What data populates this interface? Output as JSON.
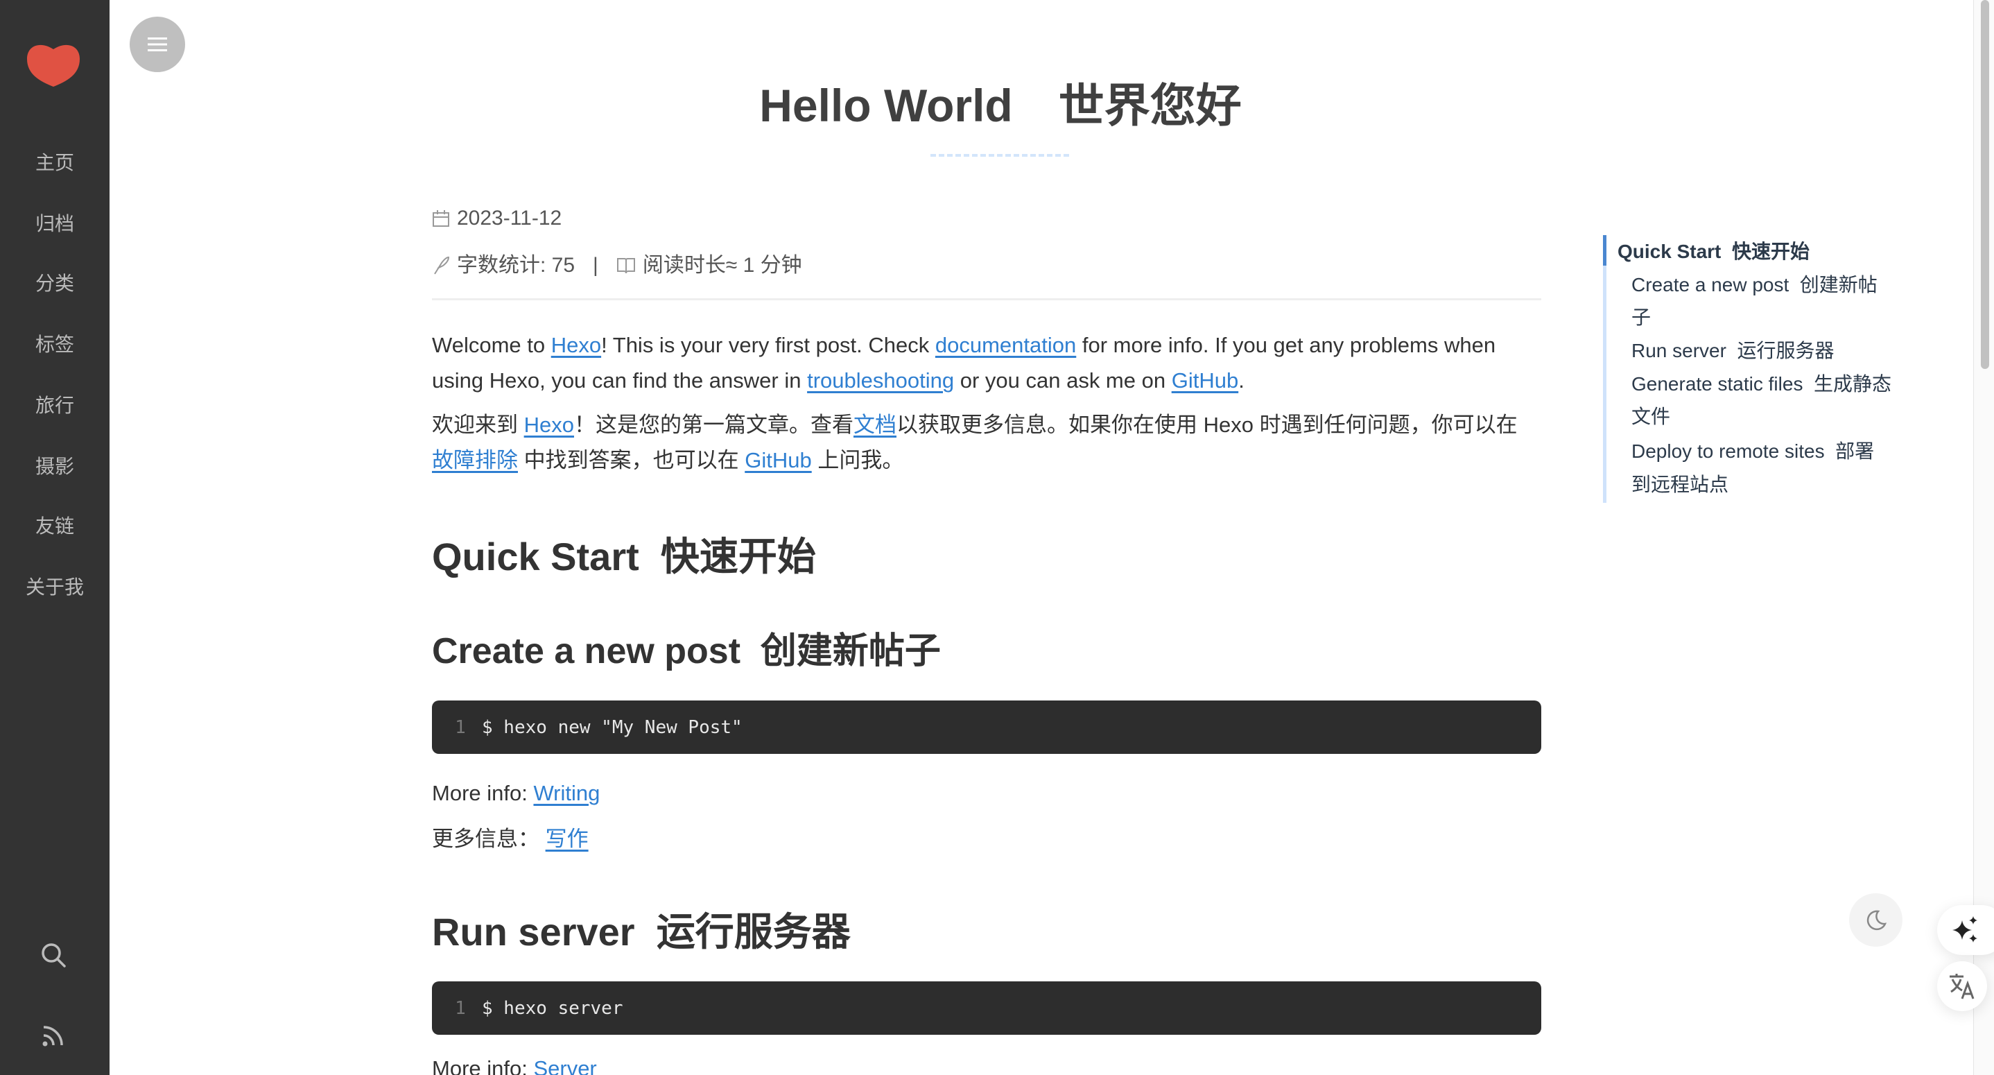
{
  "sidebar": {
    "logo_icon": "heart-icon",
    "logo_color": "#e05243",
    "items": [
      {
        "label": "主页"
      },
      {
        "label": "归档"
      },
      {
        "label": "分类"
      },
      {
        "label": "标签"
      },
      {
        "label": "旅行"
      },
      {
        "label": "摄影"
      },
      {
        "label": "友链"
      },
      {
        "label": "关于我"
      }
    ],
    "search_icon": "search-icon",
    "rss_icon": "rss-icon"
  },
  "header": {
    "menu_icon": "hamburger-icon"
  },
  "post": {
    "title": "Hello World　世界您好",
    "date": "2023-11-12",
    "word_count": "字数统计: 75",
    "separator": "|",
    "read_time": "阅读时长≈ 1 分钟",
    "para1": {
      "t1": "Welcome to ",
      "l1": "Hexo",
      "t2": "! This is your very first post. Check ",
      "l2": "documentation",
      "t3": " for more info. If you get any problems when using Hexo, you can find the answer in ",
      "l3": "troubleshooting",
      "t4": " or you can ask me on ",
      "l4": "GitHub",
      "t5": "."
    },
    "para2": {
      "t1": "欢迎来到 ",
      "l1": "Hexo",
      "t2": "！这是您的第一篇文章。查看",
      "l2": "文档",
      "t3": "以获取更多信息。如果你在使用 Hexo 时遇到任何问题，你可以在 ",
      "l3": "故障排除",
      "t4": " 中找到答案，也可以在 ",
      "l4": "GitHub",
      "t5": " 上问我。"
    },
    "h_quick_start": "Quick Start  快速开始",
    "h_create": "Create a new post  创建新帖子",
    "code1": {
      "line": "1",
      "text": "$ hexo new \"My New Post\""
    },
    "more_info1": {
      "label": "More info: ",
      "link": "Writing"
    },
    "more_info1_cn": {
      "label": "更多信息： ",
      "link": "写作"
    },
    "h_run": "Run server  运行服务器",
    "code2": {
      "line": "1",
      "text": "$ hexo server"
    },
    "more_info2": {
      "label": "More info: ",
      "link": "Server"
    }
  },
  "toc": [
    {
      "label": "Quick Start  快速开始",
      "active": true
    },
    {
      "label": "Create a new post  创建新帖"
    },
    {
      "label": "子"
    },
    {
      "label": "Run server  运行服务器"
    },
    {
      "label": "Generate static files  生成静态"
    },
    {
      "label": "文件"
    },
    {
      "label": "Deploy to remote sites  部署"
    },
    {
      "label": "到远程站点"
    }
  ],
  "floating": {
    "dark_mode_icon": "moon-icon",
    "ai_icon": "sparkle-icon",
    "translate_icon": "translate-icon"
  },
  "colors": {
    "link": "#2f7fd1",
    "sidebar_bg": "#333333",
    "code_bg": "#2d2d2d",
    "toc_active": "#4a87d0"
  }
}
